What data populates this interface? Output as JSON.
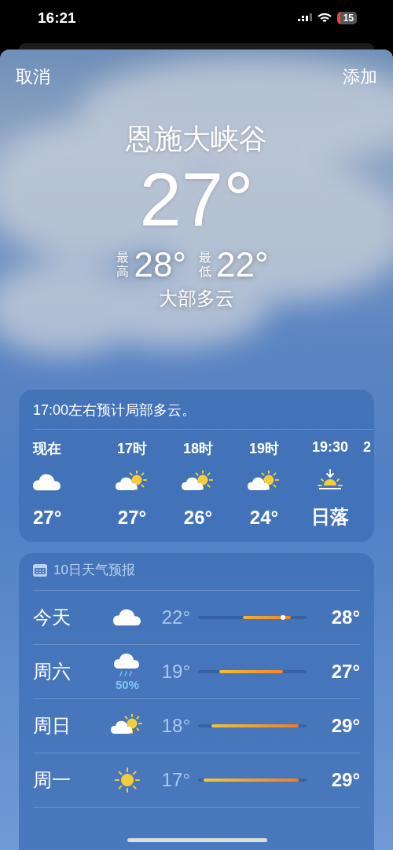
{
  "status_bar": {
    "time": "16:21",
    "battery": "15"
  },
  "nav": {
    "cancel": "取消",
    "add": "添加"
  },
  "hero": {
    "city": "恩施大峡谷",
    "temperature": "27°",
    "high_label": "最高",
    "high": "28°",
    "low_label": "最低",
    "low": "22°",
    "condition": "大部多云"
  },
  "hourly": {
    "summary": "17:00左右预计局部多云。",
    "items": [
      {
        "label": "现在",
        "kind": "cloud",
        "value": "27°"
      },
      {
        "label": "17时",
        "kind": "sun-cloud",
        "value": "27°"
      },
      {
        "label": "18时",
        "kind": "sun-cloud",
        "value": "26°"
      },
      {
        "label": "19时",
        "kind": "sun-cloud",
        "value": "24°"
      },
      {
        "label": "19:30",
        "kind": "sunset",
        "value": "日落"
      },
      {
        "label": "2"
      }
    ]
  },
  "daily": {
    "title": "10日天气预报",
    "days": [
      {
        "name": "今天",
        "kind": "cloud",
        "low": "22°",
        "high": "28°",
        "now_marker": true
      },
      {
        "name": "周六",
        "kind": "rain",
        "precip": "50%",
        "low": "19°",
        "high": "27°",
        "now_marker": false
      },
      {
        "name": "周日",
        "kind": "sun-cloud",
        "low": "18°",
        "high": "29°",
        "now_marker": false
      },
      {
        "name": "周一",
        "kind": "sun",
        "low": "17°",
        "high": "29°",
        "now_marker": false
      }
    ]
  }
}
